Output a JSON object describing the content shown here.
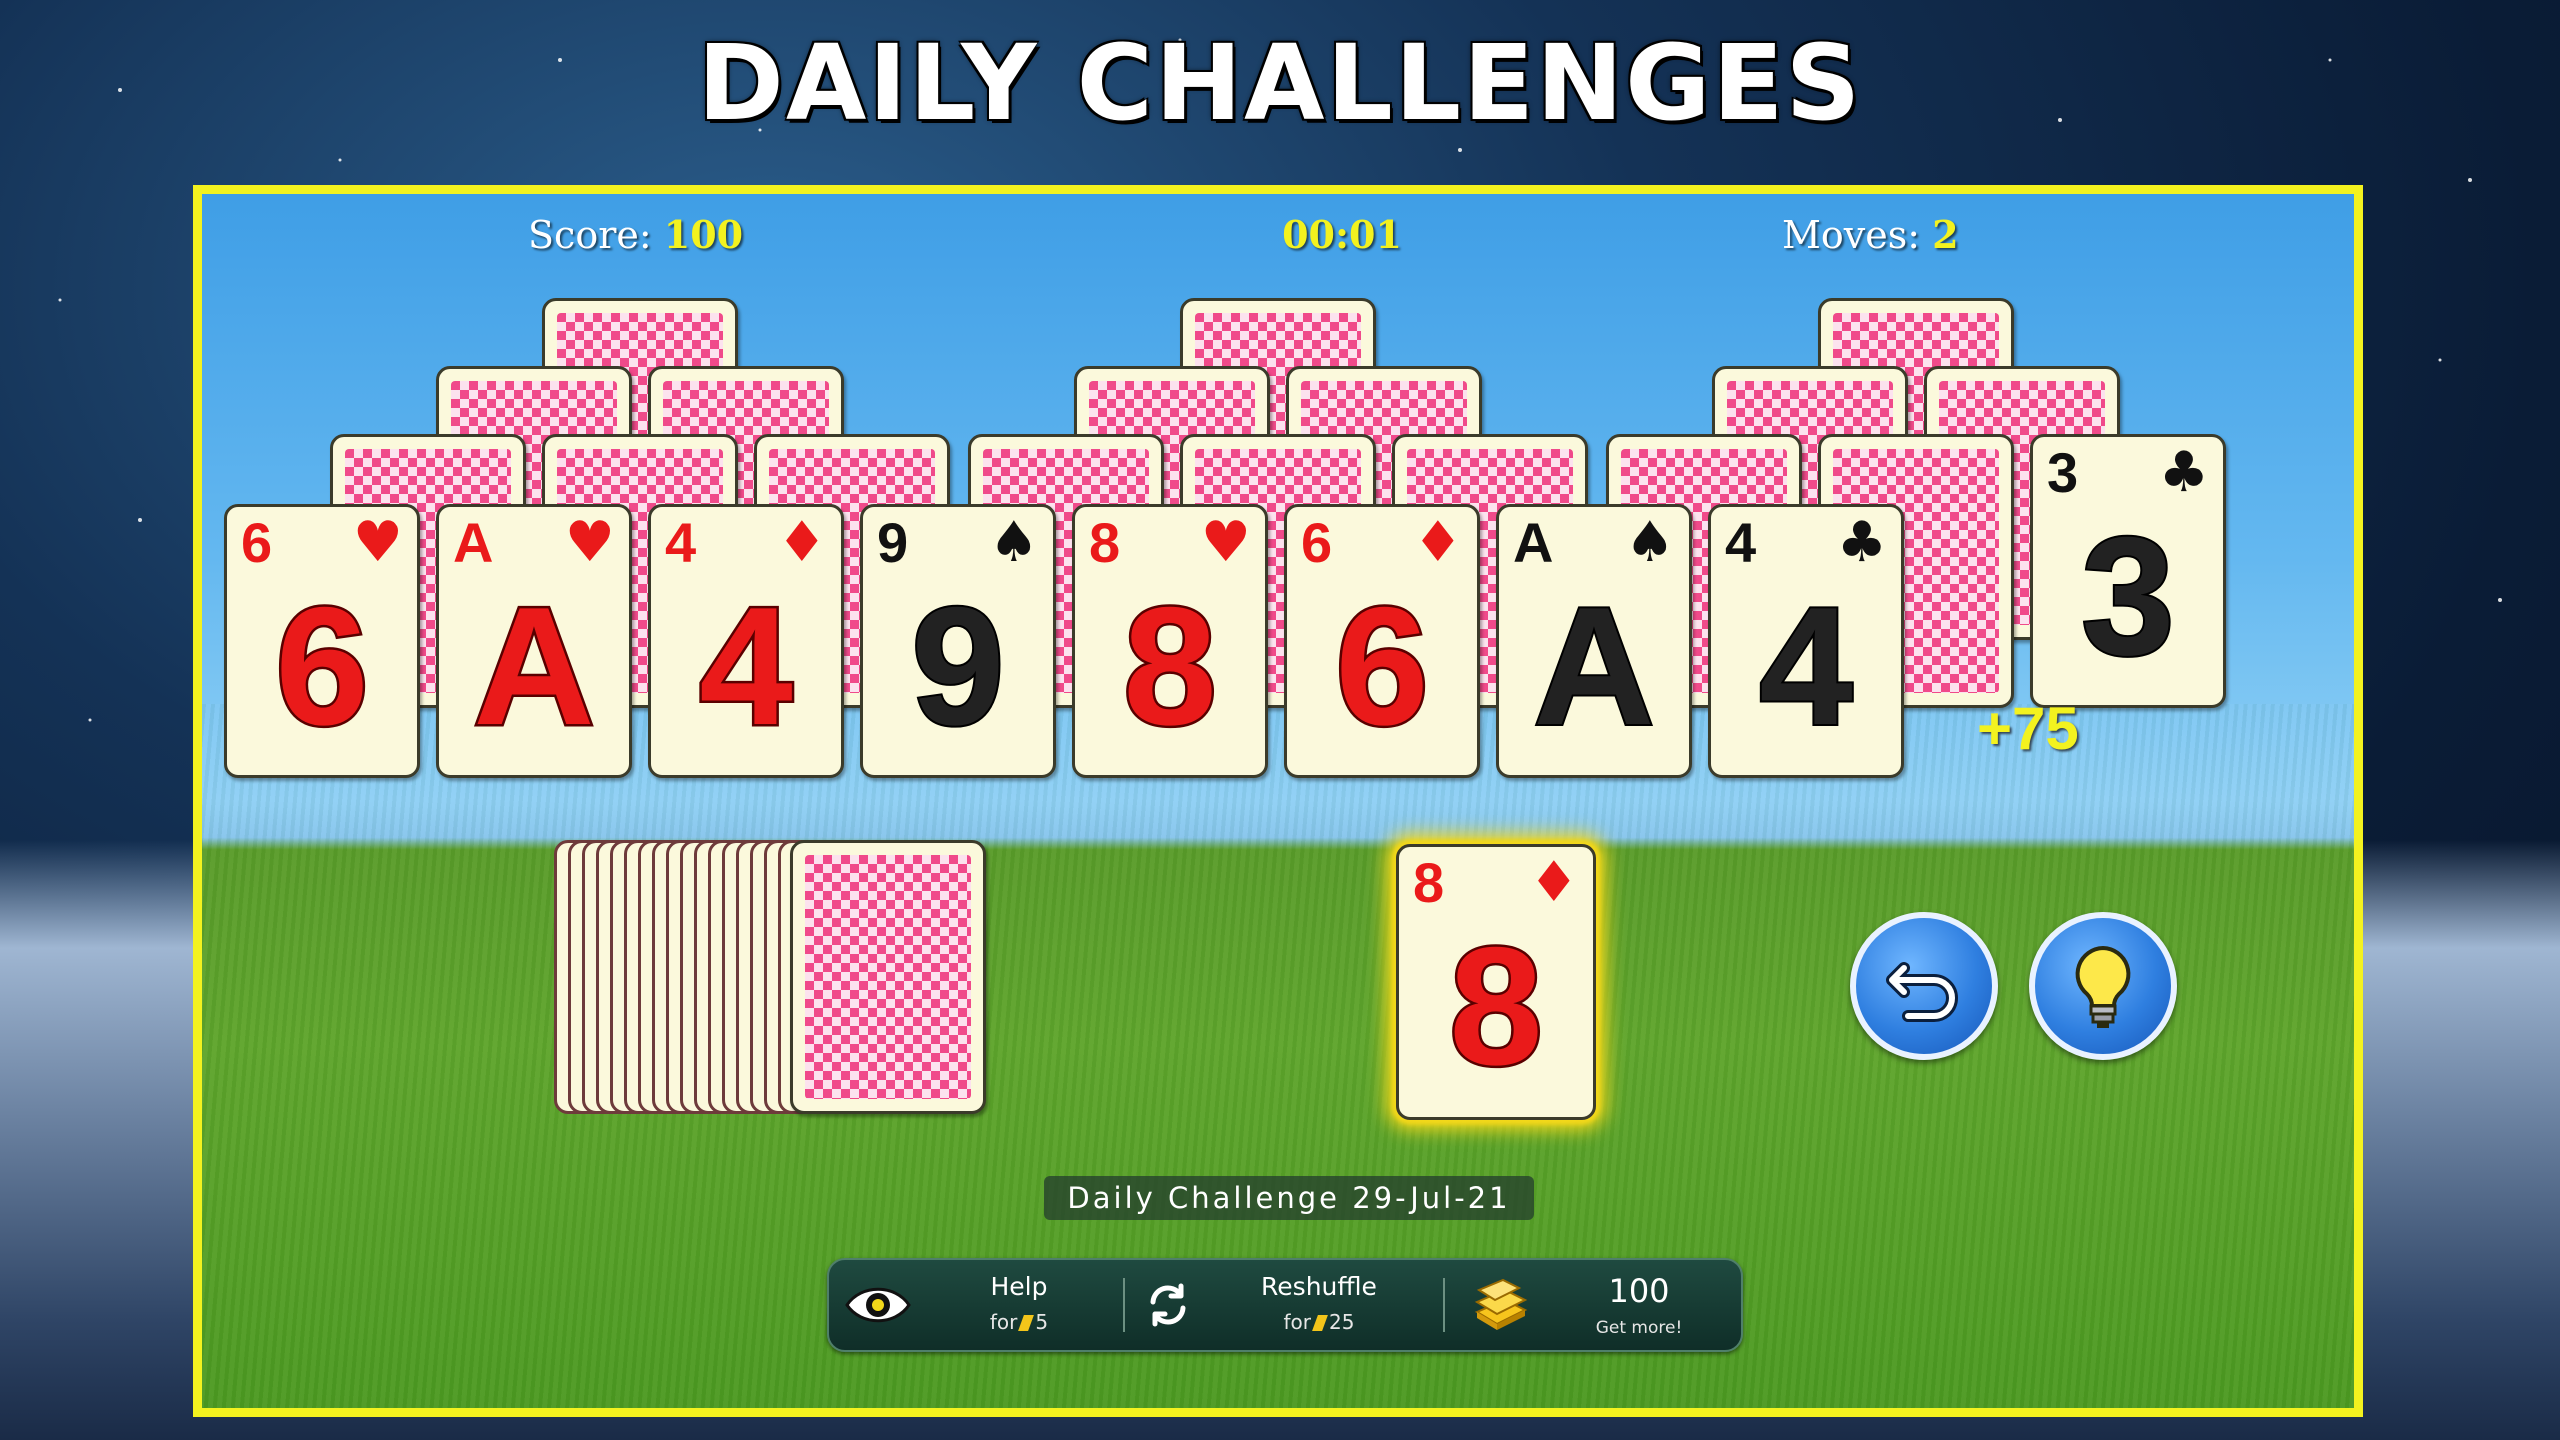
{
  "promo": {
    "title": "DAILY CHALLENGES"
  },
  "hud": {
    "score_label": "Score:",
    "score_value": "100",
    "timer": "00:01",
    "moves_label": "Moves:",
    "moves_value": "2"
  },
  "bottom_row": [
    {
      "rank": "6",
      "suit": "♥",
      "color": "red"
    },
    {
      "rank": "A",
      "suit": "♥",
      "color": "red"
    },
    {
      "rank": "4",
      "suit": "♦",
      "color": "red"
    },
    {
      "rank": "9",
      "suit": "♠",
      "color": "black"
    },
    {
      "rank": "8",
      "suit": "♥",
      "color": "red"
    },
    {
      "rank": "6",
      "suit": "♦",
      "color": "red"
    },
    {
      "rank": "A",
      "suit": "♠",
      "color": "black"
    },
    {
      "rank": "4",
      "suit": "♣",
      "color": "black"
    }
  ],
  "moved_card": {
    "rank": "3",
    "suit": "♣",
    "color": "black"
  },
  "bonus": "+75",
  "waste_card": {
    "rank": "8",
    "suit": "♦",
    "color": "red"
  },
  "date_banner": "Daily Challenge 29-Jul-21",
  "toolbar": {
    "help_label": "Help",
    "help_cost_prefix": "for",
    "help_cost": "5",
    "reshuffle_label": "Reshuffle",
    "reshuffle_cost_prefix": "for",
    "reshuffle_cost": "25",
    "coins": "100",
    "get_more": "Get more!"
  },
  "colors": {
    "frame": "#f3f21f",
    "accent_yellow": "#f3f21f",
    "card_red": "#ea1a1a",
    "card_face": "#fbf9dc"
  },
  "icons": [
    "undo-icon",
    "lightbulb-icon",
    "eye-icon",
    "reshuffle-icon",
    "gold-stack-icon"
  ]
}
